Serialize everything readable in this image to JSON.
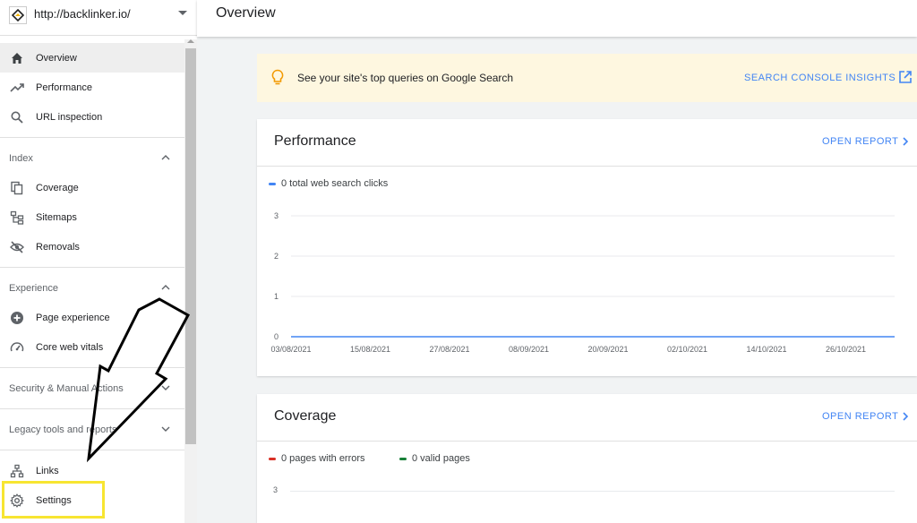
{
  "property": {
    "url": "http://backlinker.io/"
  },
  "header": {
    "title": "Overview"
  },
  "nav": {
    "top_items": [
      {
        "label": "Overview",
        "icon": "home-icon"
      },
      {
        "label": "Performance",
        "icon": "trending-up-icon"
      },
      {
        "label": "URL inspection",
        "icon": "search-icon"
      }
    ],
    "sections": [
      {
        "label": "Index",
        "items": [
          {
            "label": "Coverage",
            "icon": "coverage-icon"
          },
          {
            "label": "Sitemaps",
            "icon": "sitemap-icon"
          },
          {
            "label": "Removals",
            "icon": "eye-off-icon"
          }
        ]
      },
      {
        "label": "Experience",
        "items": [
          {
            "label": "Page experience",
            "icon": "plus-circle-icon"
          },
          {
            "label": "Core web vitals",
            "icon": "gauge-icon"
          }
        ]
      },
      {
        "label": "Security & Manual Actions",
        "items": []
      },
      {
        "label": "Legacy tools and reports",
        "items": []
      }
    ],
    "bottom_items": [
      {
        "label": "Links",
        "icon": "links-icon"
      },
      {
        "label": "Settings",
        "icon": "gear-icon"
      }
    ]
  },
  "banner": {
    "text": "See your site's top queries on Google Search",
    "link": "SEARCH CONSOLE INSIGHTS",
    "icon": "lightbulb-icon"
  },
  "performance": {
    "title": "Performance",
    "open_report": "OPEN REPORT",
    "legend": "0 total web search clicks",
    "legend_color": "#4285f4"
  },
  "coverage": {
    "title": "Coverage",
    "open_report": "OPEN REPORT",
    "legend": [
      {
        "label": "0 pages with errors",
        "color": "#d93025"
      },
      {
        "label": "0 valid pages",
        "color": "#188038"
      }
    ],
    "first_tick": "3"
  },
  "chart_data": {
    "type": "line",
    "title": "",
    "x": [
      "03/08/2021",
      "15/08/2021",
      "27/08/2021",
      "08/09/2021",
      "20/09/2021",
      "02/10/2021",
      "14/10/2021",
      "26/10/2021"
    ],
    "series": [
      {
        "name": "0 total web search clicks",
        "values": [
          0,
          0,
          0,
          0,
          0,
          0,
          0,
          0
        ]
      }
    ],
    "yticks": [
      "0",
      "1",
      "2",
      "3"
    ],
    "ylim": [
      0,
      3
    ],
    "grid": true,
    "legend": "top-left"
  },
  "annotation": {
    "arrow_color": "#000000",
    "highlight_color": "#f7e531"
  }
}
